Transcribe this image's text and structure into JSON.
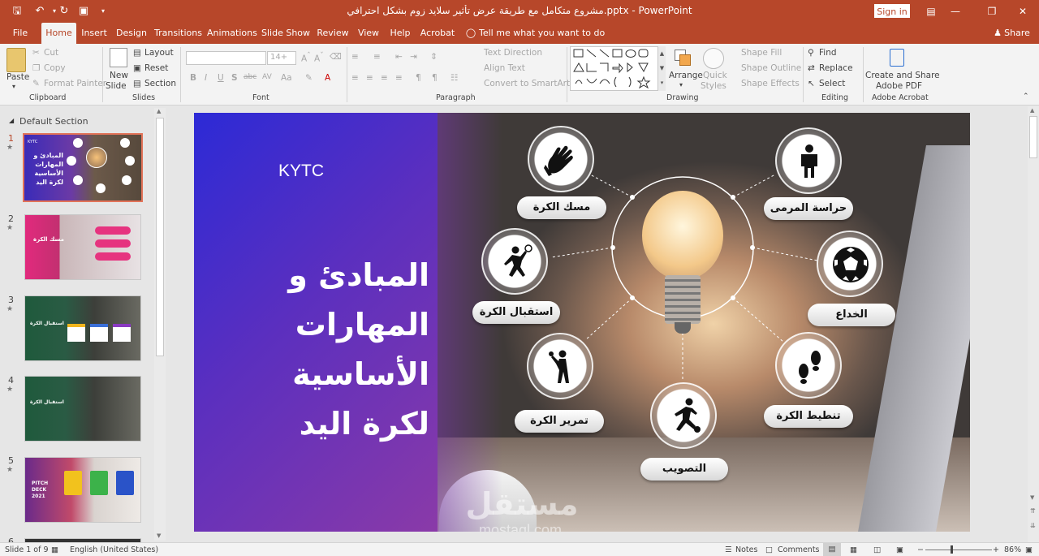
{
  "titlebar": {
    "doc_title": "مشروع متكامل مع طريقة عرض تأثير سلايد زوم بشكل احترافي.pptx - PowerPoint",
    "sign_in": "Sign in",
    "share": "Share"
  },
  "tabs": [
    "File",
    "Home",
    "Insert",
    "Design",
    "Transitions",
    "Animations",
    "Slide Show",
    "Review",
    "View",
    "Help",
    "Acrobat"
  ],
  "tell_me": "Tell me what you want to do",
  "ribbon": {
    "clipboard": {
      "paste": "Paste",
      "cut": "Cut",
      "copy": "Copy",
      "format_painter": "Format Painter",
      "label": "Clipboard"
    },
    "slides": {
      "new_slide_1": "New",
      "new_slide_2": "Slide",
      "layout": "Layout",
      "reset": "Reset",
      "section": "Section",
      "label": "Slides"
    },
    "font": {
      "size": "14+",
      "label": "Font"
    },
    "paragraph": {
      "text_direction": "Text Direction",
      "align_text": "Align Text",
      "convert": "Convert to SmartArt",
      "label": "Paragraph"
    },
    "drawing": {
      "arrange": "Arrange",
      "quick_1": "Quick",
      "quick_2": "Styles",
      "shape_fill": "Shape Fill",
      "shape_outline": "Shape Outline",
      "shape_effects": "Shape Effects",
      "label": "Drawing"
    },
    "editing": {
      "find": "Find",
      "replace": "Replace",
      "select": "Select",
      "label": "Editing"
    },
    "acrobat": {
      "create_1": "Create and Share",
      "create_2": "Adobe PDF",
      "label": "Adobe Acrobat"
    }
  },
  "panel": {
    "section": "Default Section",
    "slides": [
      "1",
      "2",
      "3",
      "4",
      "5",
      "6"
    ],
    "thumb2_text": "مسك الكرة",
    "thumb3_text": "استقبال الكرة",
    "thumb4_text": "استقبال الكرة",
    "thumb5_text_1": "PITCH",
    "thumb5_text_2": "DECK",
    "thumb5_text_3": "2021"
  },
  "slide": {
    "brand": "KYTC",
    "title_lines": [
      "المبادئ و",
      "المهارات",
      "الأساسية",
      "لكرة اليد"
    ],
    "skills": {
      "catch": "مسك الكرة",
      "goalkeeping": "حراسة المرمى",
      "receive": "استقبال الكرة",
      "feint": "الخداع",
      "pass": "تمرير الكرة",
      "dribble": "تنطيط الكرة",
      "shoot": "التصويب"
    },
    "watermark_ar": "مستقل",
    "watermark_en": "mostaql.com"
  },
  "status": {
    "slide_of": "Slide 1 of 9",
    "language": "English (United States)",
    "notes": "Notes",
    "comments": "Comments",
    "zoom": "86%"
  },
  "colors": {
    "accent": "#b7472a"
  }
}
